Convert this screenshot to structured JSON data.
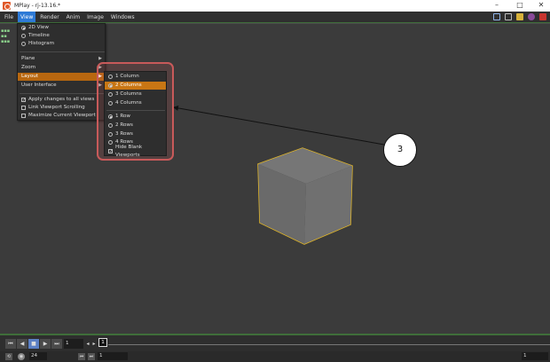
{
  "window": {
    "title": "MPlay - rj-13.16.*"
  },
  "menubar": {
    "items": [
      "File",
      "View",
      "Render",
      "Anim",
      "Image",
      "Windows"
    ],
    "active_index": 1
  },
  "view_menu": {
    "radio_items": [
      {
        "label": "2D View",
        "selected": true
      },
      {
        "label": "Timeline",
        "selected": false
      },
      {
        "label": "Histogram",
        "selected": false
      }
    ],
    "submenu_items": [
      "Plane",
      "Zoom",
      "Layout",
      "User Interface"
    ],
    "highlighted_submenu": "Layout",
    "check_items": [
      {
        "label": "Apply changes to all views",
        "checked": true
      },
      {
        "label": "Link Viewport Scrolling",
        "checked": false
      },
      {
        "label": "Maximize Current Viewport",
        "checked": false
      }
    ]
  },
  "layout_submenu": {
    "columns": [
      {
        "label": "1 Column",
        "selected": false
      },
      {
        "label": "2 Columns",
        "selected": true
      },
      {
        "label": "3 Columns",
        "selected": false
      },
      {
        "label": "4 Columns",
        "selected": false
      }
    ],
    "rows": [
      {
        "label": "1 Row",
        "selected": true
      },
      {
        "label": "2 Rows",
        "selected": false
      },
      {
        "label": "3 Rows",
        "selected": false
      },
      {
        "label": "4 Rows",
        "selected": false
      }
    ],
    "hide_blank": {
      "label": "Hide Blank Viewports",
      "checked": true
    }
  },
  "callout": {
    "number": "3"
  },
  "timeline": {
    "current_frame": "1",
    "marker_frame": "1"
  },
  "statusbar": {
    "fps": "24",
    "start": "1",
    "end": "1"
  },
  "colors": {
    "menu_highlight": "#b8670f",
    "submenu_highlight": "#c97614",
    "annotation_box": "#c85a5a",
    "cube_outline": "#e2b626",
    "accent_blue": "#2d7ad6"
  }
}
